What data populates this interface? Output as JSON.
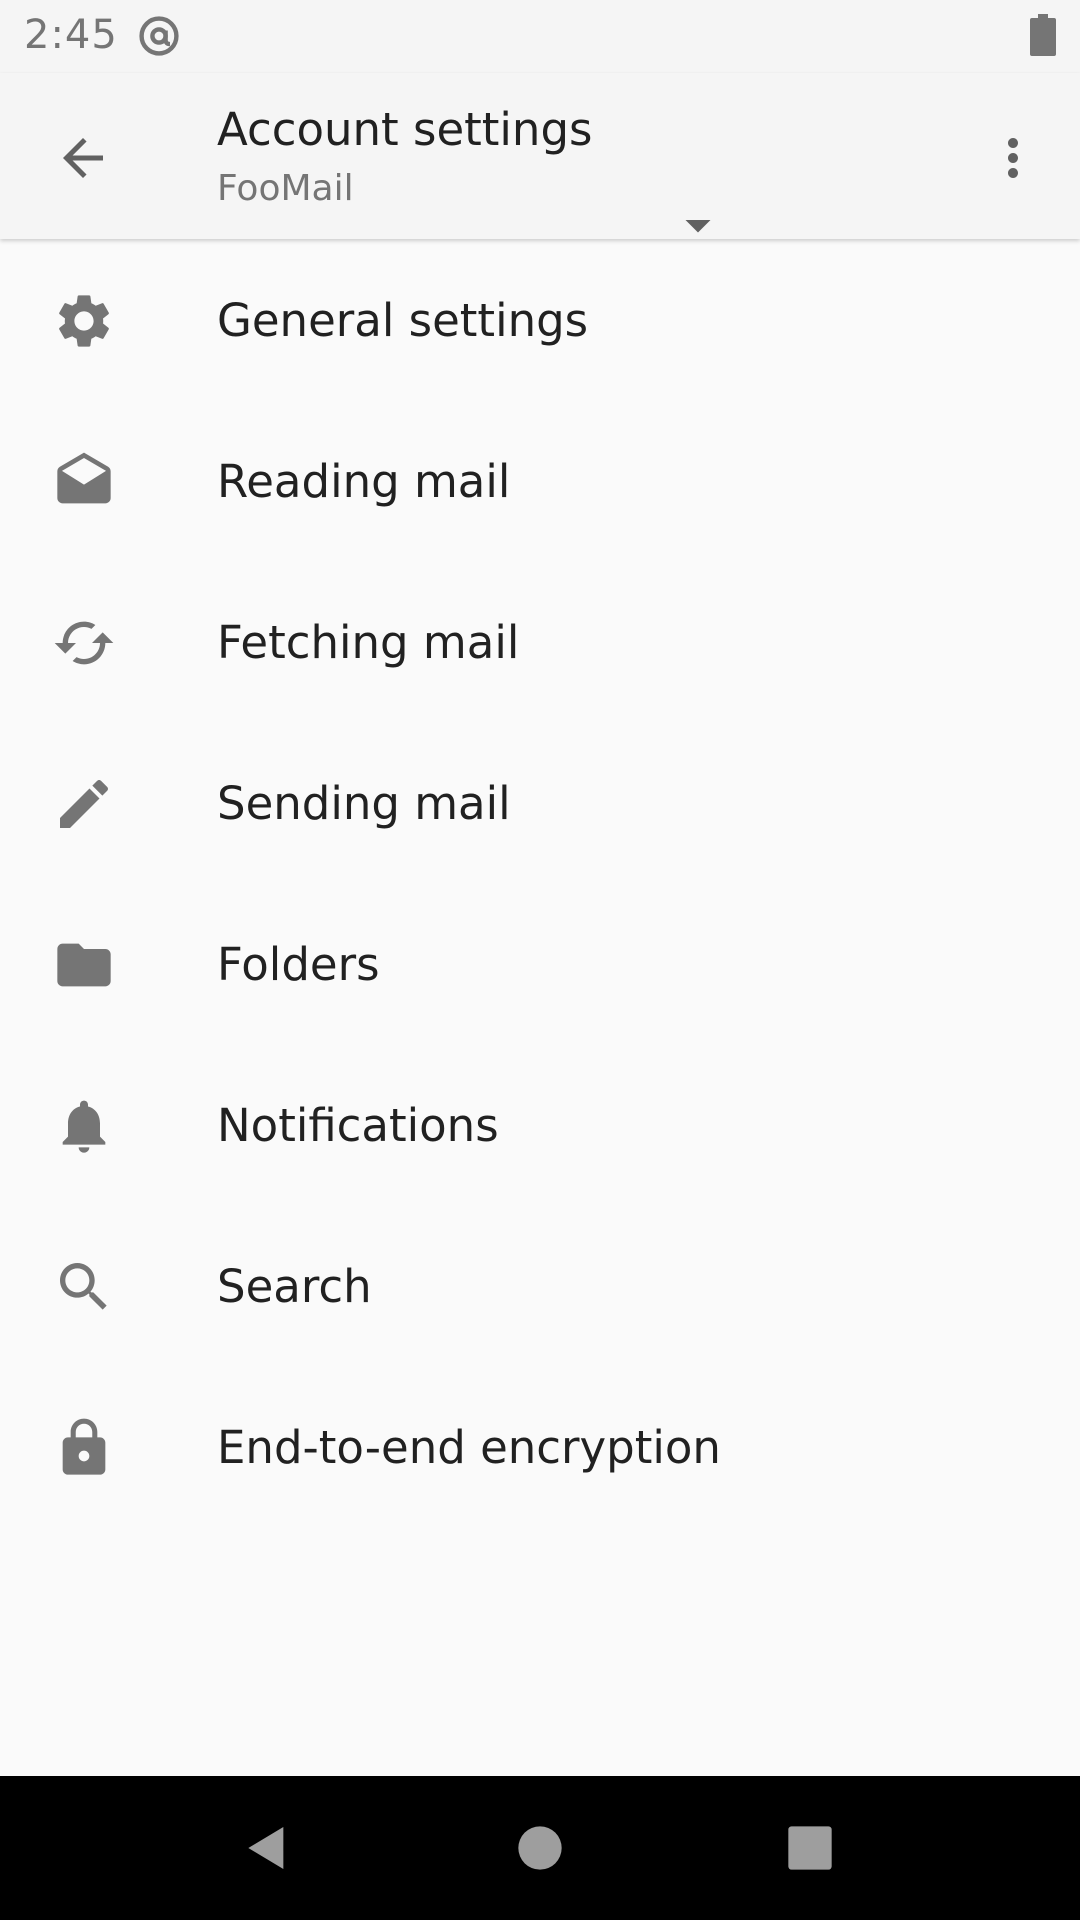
{
  "status_bar": {
    "time": "2:45",
    "icons": [
      "at-sign-icon",
      "battery-icon"
    ]
  },
  "app_bar": {
    "title": "Account settings",
    "subtitle": "FooMail",
    "icons": {
      "back": "arrow-back-icon",
      "dropdown": "arrow-drop-down-icon",
      "more": "more-vert-icon"
    }
  },
  "settings": {
    "items": [
      {
        "label": "General settings",
        "icon": "gear-icon"
      },
      {
        "label": "Reading mail",
        "icon": "mail-open-icon"
      },
      {
        "label": "Fetching mail",
        "icon": "sync-icon"
      },
      {
        "label": "Sending mail",
        "icon": "pencil-icon"
      },
      {
        "label": "Folders",
        "icon": "folder-icon"
      },
      {
        "label": "Notifications",
        "icon": "bell-icon"
      },
      {
        "label": "Search",
        "icon": "search-icon"
      },
      {
        "label": "End-to-end encryption",
        "icon": "lock-icon"
      }
    ]
  },
  "nav_bar": {
    "icons": [
      "nav-back-icon",
      "nav-home-icon",
      "nav-recents-icon"
    ]
  },
  "colors": {
    "background": "#fafafa",
    "app_bar": "#f5f5f5",
    "icon": "#757575",
    "text_primary": "#212121",
    "text_secondary": "#757575",
    "nav_bar": "#000000",
    "nav_icon": "#9e9e9e"
  }
}
